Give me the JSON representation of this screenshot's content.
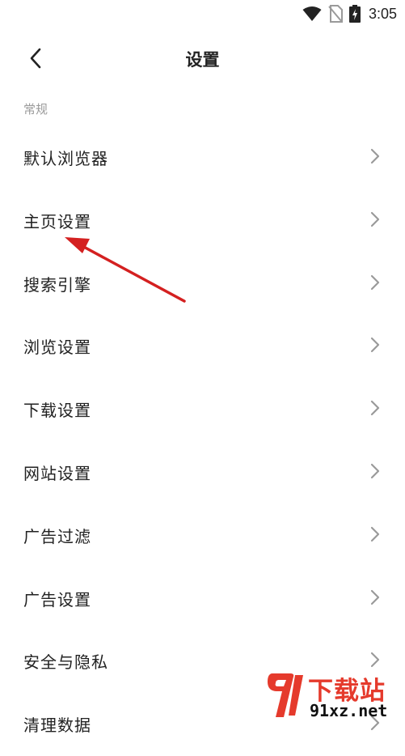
{
  "status_bar": {
    "time": "3:05",
    "icons": [
      "wifi-icon",
      "no-sim-icon",
      "battery-charging-icon"
    ]
  },
  "header": {
    "title": "设置",
    "back_icon": "chevron-left-icon"
  },
  "section": {
    "label": "常规"
  },
  "settings": {
    "items": [
      {
        "label": "默认浏览器"
      },
      {
        "label": "主页设置"
      },
      {
        "label": "搜索引擎"
      },
      {
        "label": "浏览设置"
      },
      {
        "label": "下载设置"
      },
      {
        "label": "网站设置"
      },
      {
        "label": "广告过滤"
      },
      {
        "label": "广告设置"
      },
      {
        "label": "安全与隐私"
      },
      {
        "label": "清理数据"
      }
    ],
    "chevron_icon": "chevron-right-icon"
  },
  "annotation": {
    "arrow_color": "#d42020"
  },
  "watermark": {
    "title": "下载站",
    "url": "91xz.net",
    "color": "#e53a2c"
  }
}
